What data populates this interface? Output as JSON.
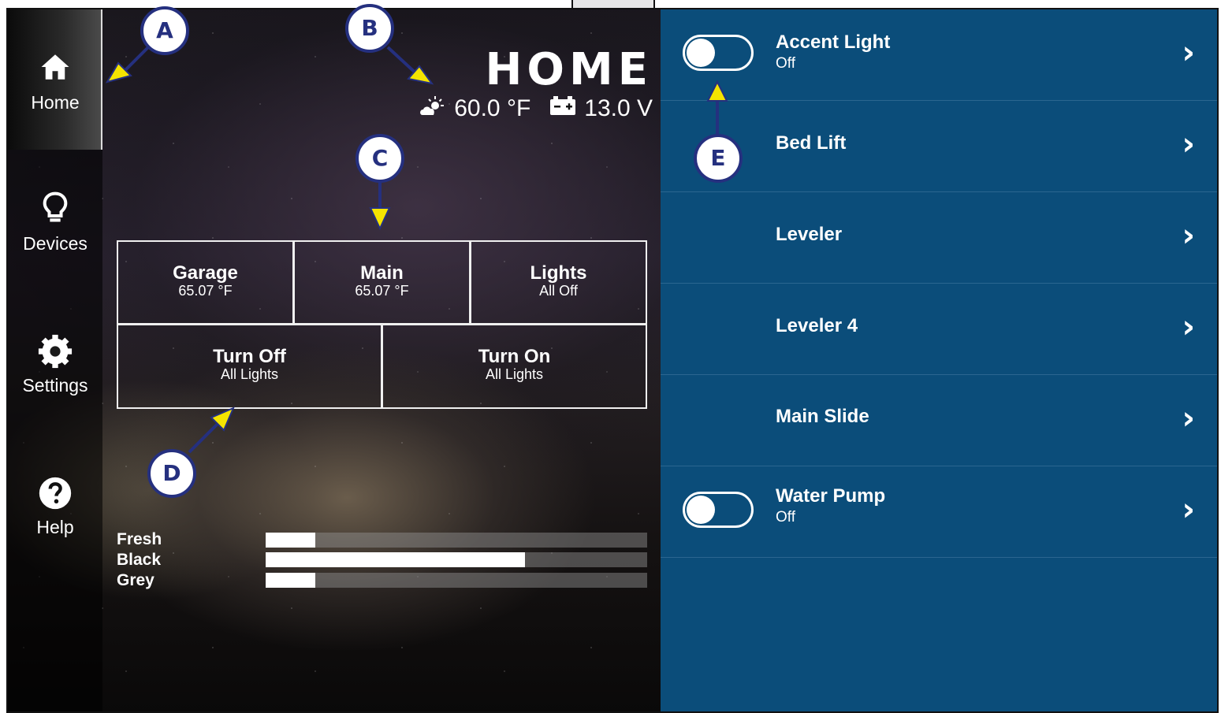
{
  "sidebar": {
    "items": [
      {
        "label": "Home",
        "icon": "home-icon"
      },
      {
        "label": "Devices",
        "icon": "lightbulb-icon"
      },
      {
        "label": "Settings",
        "icon": "gear-icon"
      },
      {
        "label": "Help",
        "icon": "help-icon"
      }
    ]
  },
  "header": {
    "title": "HOME",
    "temperature": "60.0 °F",
    "voltage": "13.0 V"
  },
  "tiles": [
    {
      "title": "Garage",
      "sub": "65.07 °F"
    },
    {
      "title": "Main",
      "sub": "65.07 °F"
    },
    {
      "title": "Lights",
      "sub": "All Off"
    },
    {
      "title": "Turn Off",
      "sub": "All Lights"
    },
    {
      "title": "Turn On",
      "sub": "All Lights"
    }
  ],
  "tanks": [
    {
      "label": "Fresh",
      "level": 0.13
    },
    {
      "label": "Black",
      "level": 0.68
    },
    {
      "label": "Grey",
      "level": 0.13
    }
  ],
  "devices": [
    {
      "name": "Accent Light",
      "status": "Off",
      "toggle": true
    },
    {
      "name": "Bed Lift",
      "status": "",
      "toggle": false
    },
    {
      "name": "Leveler",
      "status": "",
      "toggle": false
    },
    {
      "name": "Leveler 4",
      "status": "",
      "toggle": false
    },
    {
      "name": "Main Slide",
      "status": "",
      "toggle": false
    },
    {
      "name": "Water Pump",
      "status": "Off",
      "toggle": true
    }
  ],
  "callouts": [
    "A",
    "B",
    "C",
    "D",
    "E"
  ],
  "colors": {
    "panel": "#0b4d7a",
    "callout_border": "#25307f",
    "arrow_fill": "#f5e400"
  }
}
